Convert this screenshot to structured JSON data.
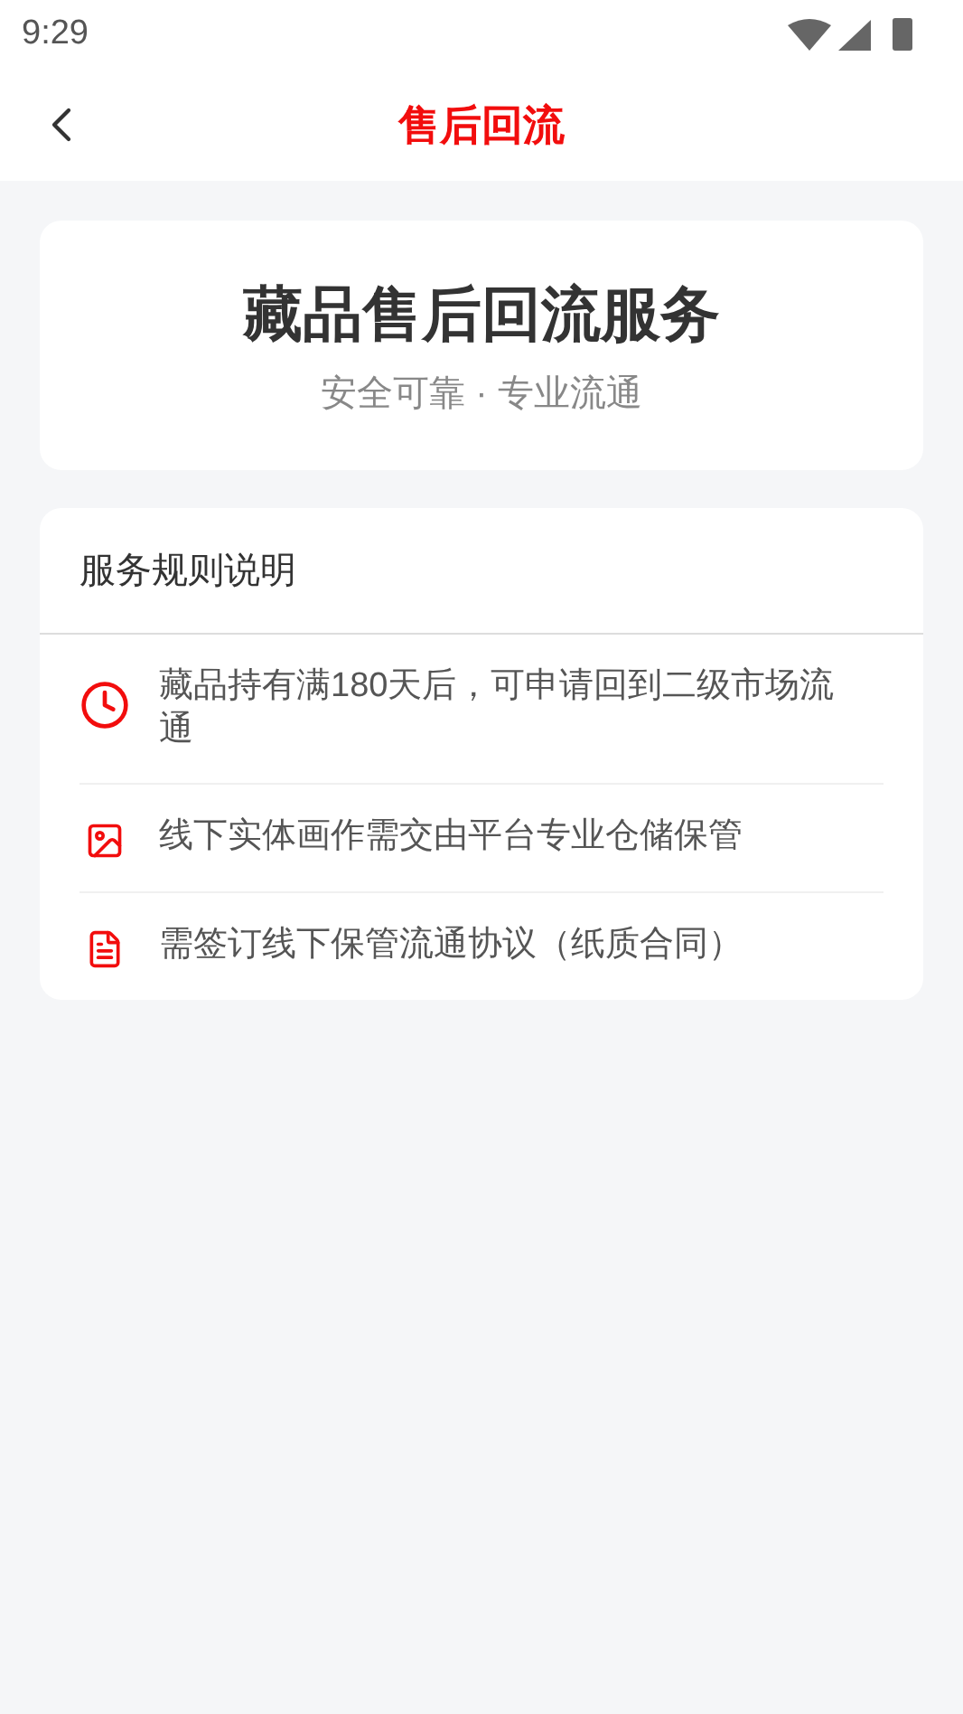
{
  "status_bar": {
    "time": "9:29"
  },
  "header": {
    "title": "售后回流"
  },
  "hero": {
    "title": "藏品售后回流服务",
    "subtitle": "安全可靠 · 专业流通"
  },
  "rules": {
    "title": "服务规则说明",
    "items": [
      {
        "kind": "clock",
        "text": "藏品持有满180天后，可申请回到二级市场流通"
      },
      {
        "kind": "image",
        "text": "线下实体画作需交由平台专业仓储保管"
      },
      {
        "kind": "document",
        "text": "需签订线下保管流通协议（纸质合同）"
      }
    ]
  }
}
